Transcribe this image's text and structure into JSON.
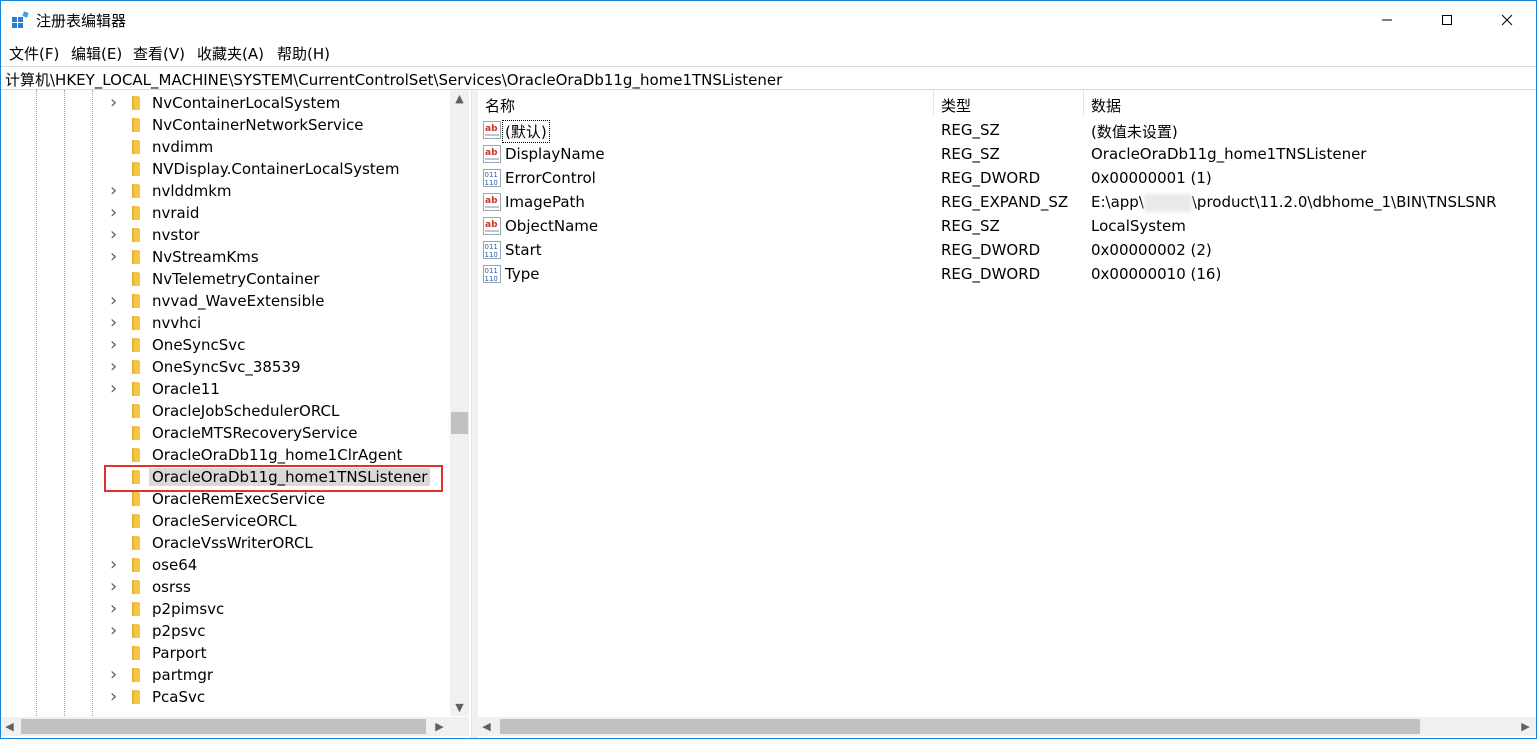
{
  "window": {
    "title": "注册表编辑器",
    "controls": {
      "minimize": "minimize-icon",
      "maximize": "maximize-icon",
      "close": "close-icon"
    }
  },
  "menu": [
    {
      "label": "文件(F)"
    },
    {
      "label": "编辑(E)"
    },
    {
      "label": "查看(V)"
    },
    {
      "label": "收藏夹(A)"
    },
    {
      "label": "帮助(H)"
    }
  ],
  "address": "计算机\\HKEY_LOCAL_MACHINE\\SYSTEM\\CurrentControlSet\\Services\\OracleOraDb11g_home1TNSListener",
  "tree": {
    "items": [
      {
        "label": "NvContainerLocalSystem",
        "expandable": true
      },
      {
        "label": "NvContainerNetworkService",
        "expandable": false
      },
      {
        "label": "nvdimm",
        "expandable": false
      },
      {
        "label": "NVDisplay.ContainerLocalSystem",
        "expandable": false
      },
      {
        "label": "nvlddmkm",
        "expandable": true
      },
      {
        "label": "nvraid",
        "expandable": true
      },
      {
        "label": "nvstor",
        "expandable": true
      },
      {
        "label": "NvStreamKms",
        "expandable": true
      },
      {
        "label": "NvTelemetryContainer",
        "expandable": false
      },
      {
        "label": "nvvad_WaveExtensible",
        "expandable": true
      },
      {
        "label": "nvvhci",
        "expandable": true
      },
      {
        "label": "OneSyncSvc",
        "expandable": true
      },
      {
        "label": "OneSyncSvc_38539",
        "expandable": true
      },
      {
        "label": "Oracle11",
        "expandable": true
      },
      {
        "label": "OracleJobSchedulerORCL",
        "expandable": false
      },
      {
        "label": "OracleMTSRecoveryService",
        "expandable": false
      },
      {
        "label": "OracleOraDb11g_home1ClrAgent",
        "expandable": false
      },
      {
        "label": "OracleOraDb11g_home1TNSListener",
        "expandable": false,
        "selected": true
      },
      {
        "label": "OracleRemExecService",
        "expandable": false
      },
      {
        "label": "OracleServiceORCL",
        "expandable": false
      },
      {
        "label": "OracleVssWriterORCL",
        "expandable": false
      },
      {
        "label": "ose64",
        "expandable": true
      },
      {
        "label": "osrss",
        "expandable": true
      },
      {
        "label": "p2pimsvc",
        "expandable": true
      },
      {
        "label": "p2psvc",
        "expandable": true
      },
      {
        "label": "Parport",
        "expandable": false
      },
      {
        "label": "partmgr",
        "expandable": true
      },
      {
        "label": "PcaSvc",
        "expandable": true
      }
    ]
  },
  "values_table": {
    "headers": {
      "name": "名称",
      "type": "类型",
      "data": "数据"
    },
    "rows": [
      {
        "icon": "string-value-icon",
        "name": "(默认)",
        "type": "REG_SZ",
        "data": "(数值未设置)"
      },
      {
        "icon": "string-value-icon",
        "name": "DisplayName",
        "type": "REG_SZ",
        "data": "OracleOraDb11g_home1TNSListener"
      },
      {
        "icon": "dword-value-icon",
        "name": "ErrorControl",
        "type": "REG_DWORD",
        "data": "0x00000001 (1)"
      },
      {
        "icon": "string-value-icon",
        "name": "ImagePath",
        "type": "REG_EXPAND_SZ",
        "data_prefix": "E:\\app\\",
        "data_suffix": "\\product\\11.2.0\\dbhome_1\\BIN\\TNSLSNR"
      },
      {
        "icon": "string-value-icon",
        "name": "ObjectName",
        "type": "REG_SZ",
        "data": "LocalSystem"
      },
      {
        "icon": "dword-value-icon",
        "name": "Start",
        "type": "REG_DWORD",
        "data": "0x00000002 (2)"
      },
      {
        "icon": "dword-value-icon",
        "name": "Type",
        "type": "REG_DWORD",
        "data": "0x00000010 (16)"
      }
    ]
  },
  "colors": {
    "accent": "#1883d7",
    "selection": "#d9d9d9",
    "highlight_box": "#e03131",
    "folder": "#f5c644"
  }
}
